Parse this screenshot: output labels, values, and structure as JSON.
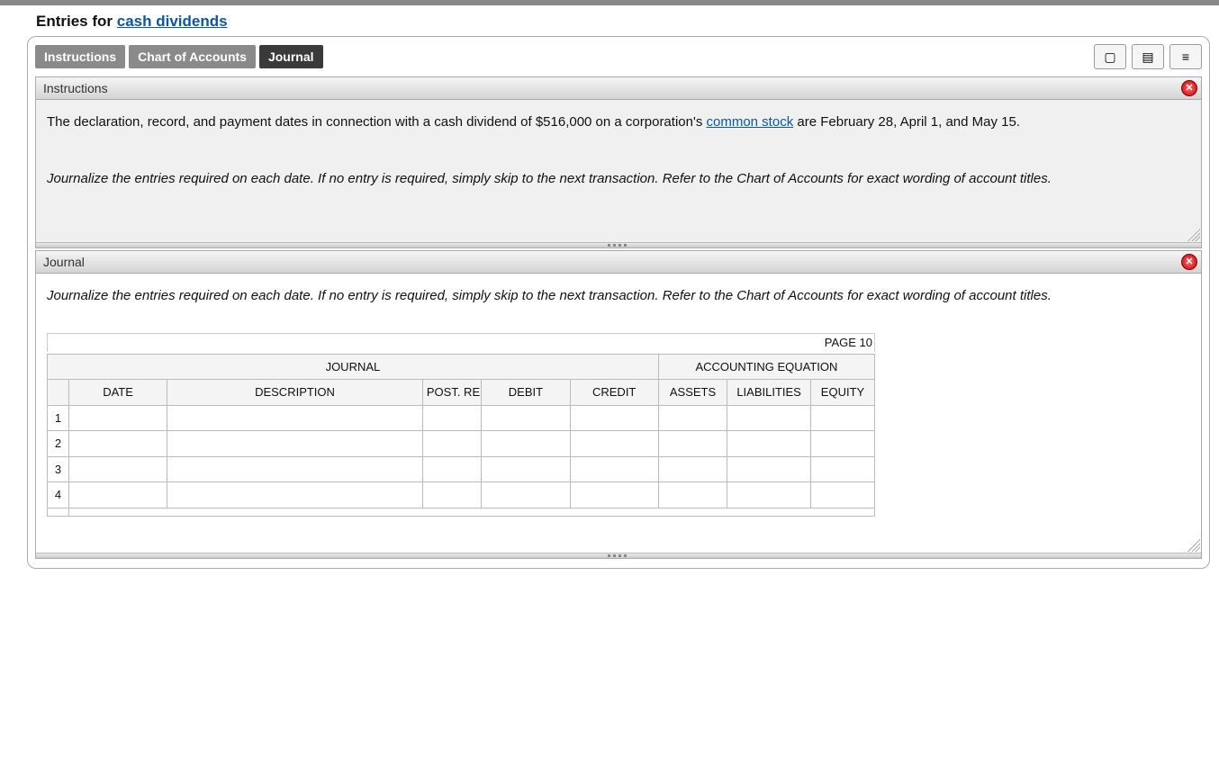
{
  "page_title_prefix": "Entries for ",
  "page_title_link": "cash dividends",
  "tabs": {
    "instructions": "Instructions",
    "chart_of_accounts": "Chart of Accounts",
    "journal": "Journal"
  },
  "panels": {
    "instructions": {
      "header": "Instructions",
      "body_part1": "The declaration, record, and payment dates in connection with a cash dividend of $516,000 on a corporation's ",
      "body_link": "common stock",
      "body_part2": " are February 28, April 1, and May 15.",
      "prompt": "Journalize the entries required on each date. If no entry is required, simply skip to the next transaction. Refer to the Chart of Accounts for exact wording of account titles."
    },
    "journal": {
      "header": "Journal",
      "prompt": "Journalize the entries required on each date. If no entry is required, simply skip to the next transaction. Refer to the Chart of Accounts for exact wording of account titles."
    }
  },
  "journal_table": {
    "page_label": "PAGE 10",
    "group_journal": "JOURNAL",
    "group_equation": "ACCOUNTING EQUATION",
    "columns": {
      "date": "DATE",
      "description": "DESCRIPTION",
      "post_ref": "POST. REF.",
      "debit": "DEBIT",
      "credit": "CREDIT",
      "assets": "ASSETS",
      "liabilities": "LIABILITIES",
      "equity": "EQUITY"
    },
    "row_numbers": [
      "1",
      "2",
      "3",
      "4"
    ]
  }
}
